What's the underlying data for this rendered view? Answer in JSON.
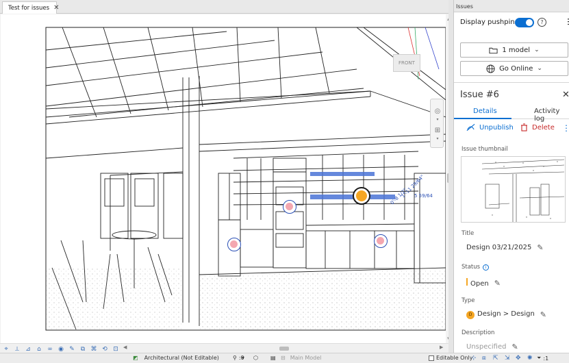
{
  "document_tab": {
    "title": "Test for issues",
    "close": "✕"
  },
  "viewcube": {
    "label": "FRONT"
  },
  "statusbar": {
    "view_name": "Architectural (Not Editable)",
    "scale": ":0",
    "model": "Main Model",
    "editable_only": "Editable Only",
    "filter_count": ":1"
  },
  "panel": {
    "title": "Issues",
    "display_pushpins_label": "Display pushpins",
    "display_pushpins_on": true,
    "model_button": "1 model",
    "go_online_button": "Go Online",
    "issue_title": "Issue #6",
    "tabs": [
      {
        "label": "Details",
        "active": true
      },
      {
        "label": "Activity log",
        "active": false
      }
    ],
    "actions": {
      "unpublish": "Unpublish",
      "delete": "Delete"
    },
    "thumbnail_label": "Issue thumbnail",
    "fields": {
      "title_label": "Title",
      "title_value": "Design 03/21/2025",
      "status_label": "Status",
      "status_value": "Open",
      "type_label": "Type",
      "type_value": "Design > Design",
      "type_badge": "D",
      "description_label": "Description",
      "description_value": "Unspecified"
    }
  },
  "dimension_text": {
    "a": "0'-8 1/2\"",
    "b": "1'-11 29/64\"",
    "c": "5 59/64"
  },
  "colors": {
    "accent": "#0a6ed1",
    "status_open": "#f5a623",
    "delete": "#c62828",
    "pushpin_fill": "#f4a7b0",
    "pushpin_selected": "#f5a623"
  }
}
